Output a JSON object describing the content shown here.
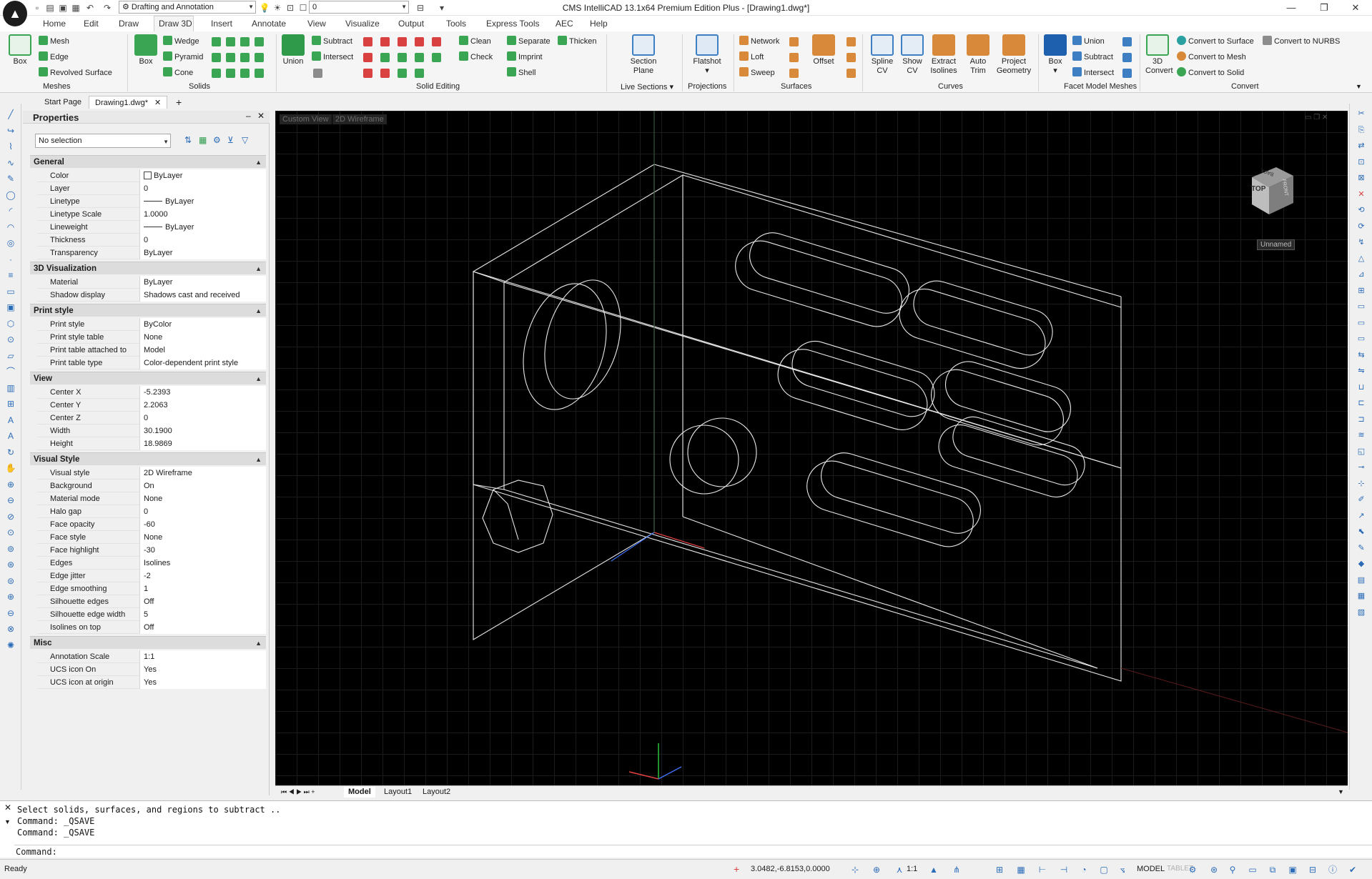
{
  "title_bar": {
    "app_icon": "intellicad-logo",
    "workspace": "Drafting and Annotation",
    "layer_value": "0",
    "window_title": "CMS IntelliCAD 13.1x64 Premium Edition Plus - [Drawing1.dwg*]",
    "quick_access_icons": [
      "new-icon",
      "open-icon",
      "save-icon",
      "save-as-icon",
      "undo-icon",
      "redo-icon"
    ]
  },
  "ribbon_tabs": [
    "Home",
    "Edit",
    "Draw",
    "Draw 3D",
    "Insert",
    "Annotate",
    "View",
    "Visualize",
    "Output",
    "Tools",
    "Express Tools",
    "AEC",
    "Help"
  ],
  "ribbon_active_tab": "Draw 3D",
  "ribbon": {
    "meshes": {
      "box": "Box",
      "mesh": "Mesh",
      "edge": "Edge",
      "revolved": "Revolved Surface",
      "label": "Meshes"
    },
    "solids": {
      "box": "Box",
      "wedge": "Wedge",
      "pyramid": "Pyramid",
      "cone": "Cone",
      "label": "Solids"
    },
    "solid_editing": {
      "union": "Union",
      "subtract": "Subtract",
      "intersect": "Intersect",
      "clean": "Clean",
      "check": "Check",
      "separate": "Separate",
      "thicken": "Thicken",
      "imprint": "Imprint",
      "shell": "Shell",
      "label": "Solid Editing"
    },
    "live_sections": {
      "section_plane": "Section Plane",
      "label": "Live Sections"
    },
    "projections": {
      "flatshot": "Flatshot",
      "label": "Projections"
    },
    "surfaces": {
      "network": "Network",
      "loft": "Loft",
      "sweep": "Sweep",
      "offset": "Offset",
      "label": "Surfaces"
    },
    "curves": {
      "spline_cv": "Spline CV",
      "show_cv": "Show CV",
      "extract_isolines": "Extract Isolines",
      "auto_trim": "Auto Trim",
      "project_geometry": "Project Geometry",
      "label": "Curves"
    },
    "facet": {
      "box": "Box",
      "union": "Union",
      "subtract": "Subtract",
      "intersect": "Intersect",
      "label": "Facet Model Meshes"
    },
    "convert": {
      "convert_3d": "3D Convert",
      "to_surface": "Convert to Surface",
      "to_nurbs": "Convert to NURBS",
      "to_mesh": "Convert to Mesh",
      "to_solid": "Convert to Solid",
      "label": "Convert"
    }
  },
  "doc_tabs": [
    "Start Page",
    "Drawing1.dwg*"
  ],
  "properties": {
    "title": "Properties",
    "selection": "No selection",
    "sections": [
      {
        "name": "General",
        "rows": [
          [
            "Color",
            "ByLayer"
          ],
          [
            "Layer",
            "0"
          ],
          [
            "Linetype",
            "ByLayer"
          ],
          [
            "Linetype Scale",
            "1.0000"
          ],
          [
            "Lineweight",
            "ByLayer"
          ],
          [
            "Thickness",
            "0"
          ],
          [
            "Transparency",
            "ByLayer"
          ]
        ]
      },
      {
        "name": "3D Visualization",
        "rows": [
          [
            "Material",
            "ByLayer"
          ],
          [
            "Shadow display",
            "Shadows cast and received"
          ]
        ]
      },
      {
        "name": "Print style",
        "rows": [
          [
            "Print style",
            "ByColor"
          ],
          [
            "Print style table",
            "None"
          ],
          [
            "Print table attached to",
            "Model"
          ],
          [
            "Print table type",
            "Color-dependent print style"
          ]
        ]
      },
      {
        "name": "View",
        "rows": [
          [
            "Center X",
            "-5.2393"
          ],
          [
            "Center Y",
            "2.2063"
          ],
          [
            "Center Z",
            "0"
          ],
          [
            "Width",
            "30.1900"
          ],
          [
            "Height",
            "18.9869"
          ]
        ]
      },
      {
        "name": "Visual Style",
        "rows": [
          [
            "Visual style",
            "2D Wireframe"
          ],
          [
            "Background",
            "On"
          ],
          [
            "Material mode",
            "None"
          ],
          [
            "Halo gap",
            "0"
          ],
          [
            "Face opacity",
            "-60"
          ],
          [
            "Face style",
            "None"
          ],
          [
            "Face highlight",
            "-30"
          ],
          [
            "Edges",
            "Isolines"
          ],
          [
            "Edge jitter",
            "-2"
          ],
          [
            "Edge smoothing",
            "1"
          ],
          [
            "Silhouette edges",
            "Off"
          ],
          [
            "Silhouette edge width",
            "5"
          ],
          [
            "Isolines on top",
            "Off"
          ]
        ]
      },
      {
        "name": "Misc",
        "rows": [
          [
            "Annotation Scale",
            "1:1"
          ],
          [
            "UCS icon On",
            "Yes"
          ],
          [
            "UCS icon at origin",
            "Yes"
          ]
        ]
      }
    ]
  },
  "viewport": {
    "view_label": "Custom View",
    "style_label": "2D Wireframe",
    "viewcube_top": "TOP",
    "viewcube_front": "FRONT",
    "viewcube_back": "BACK",
    "viewcube_named": "Unnamed"
  },
  "layout_tabs": [
    "Model",
    "Layout1",
    "Layout2"
  ],
  "command": {
    "history": [
      "Select solids, surfaces, and regions to subtract ..",
      "Command: _QSAVE",
      "Command: _QSAVE"
    ],
    "prompt": "Command:"
  },
  "status": {
    "ready": "Ready",
    "coords": "3.0482,-6.8153,0.0000",
    "scale": "1:1",
    "model": "MODEL",
    "tablet": "TABLET"
  }
}
